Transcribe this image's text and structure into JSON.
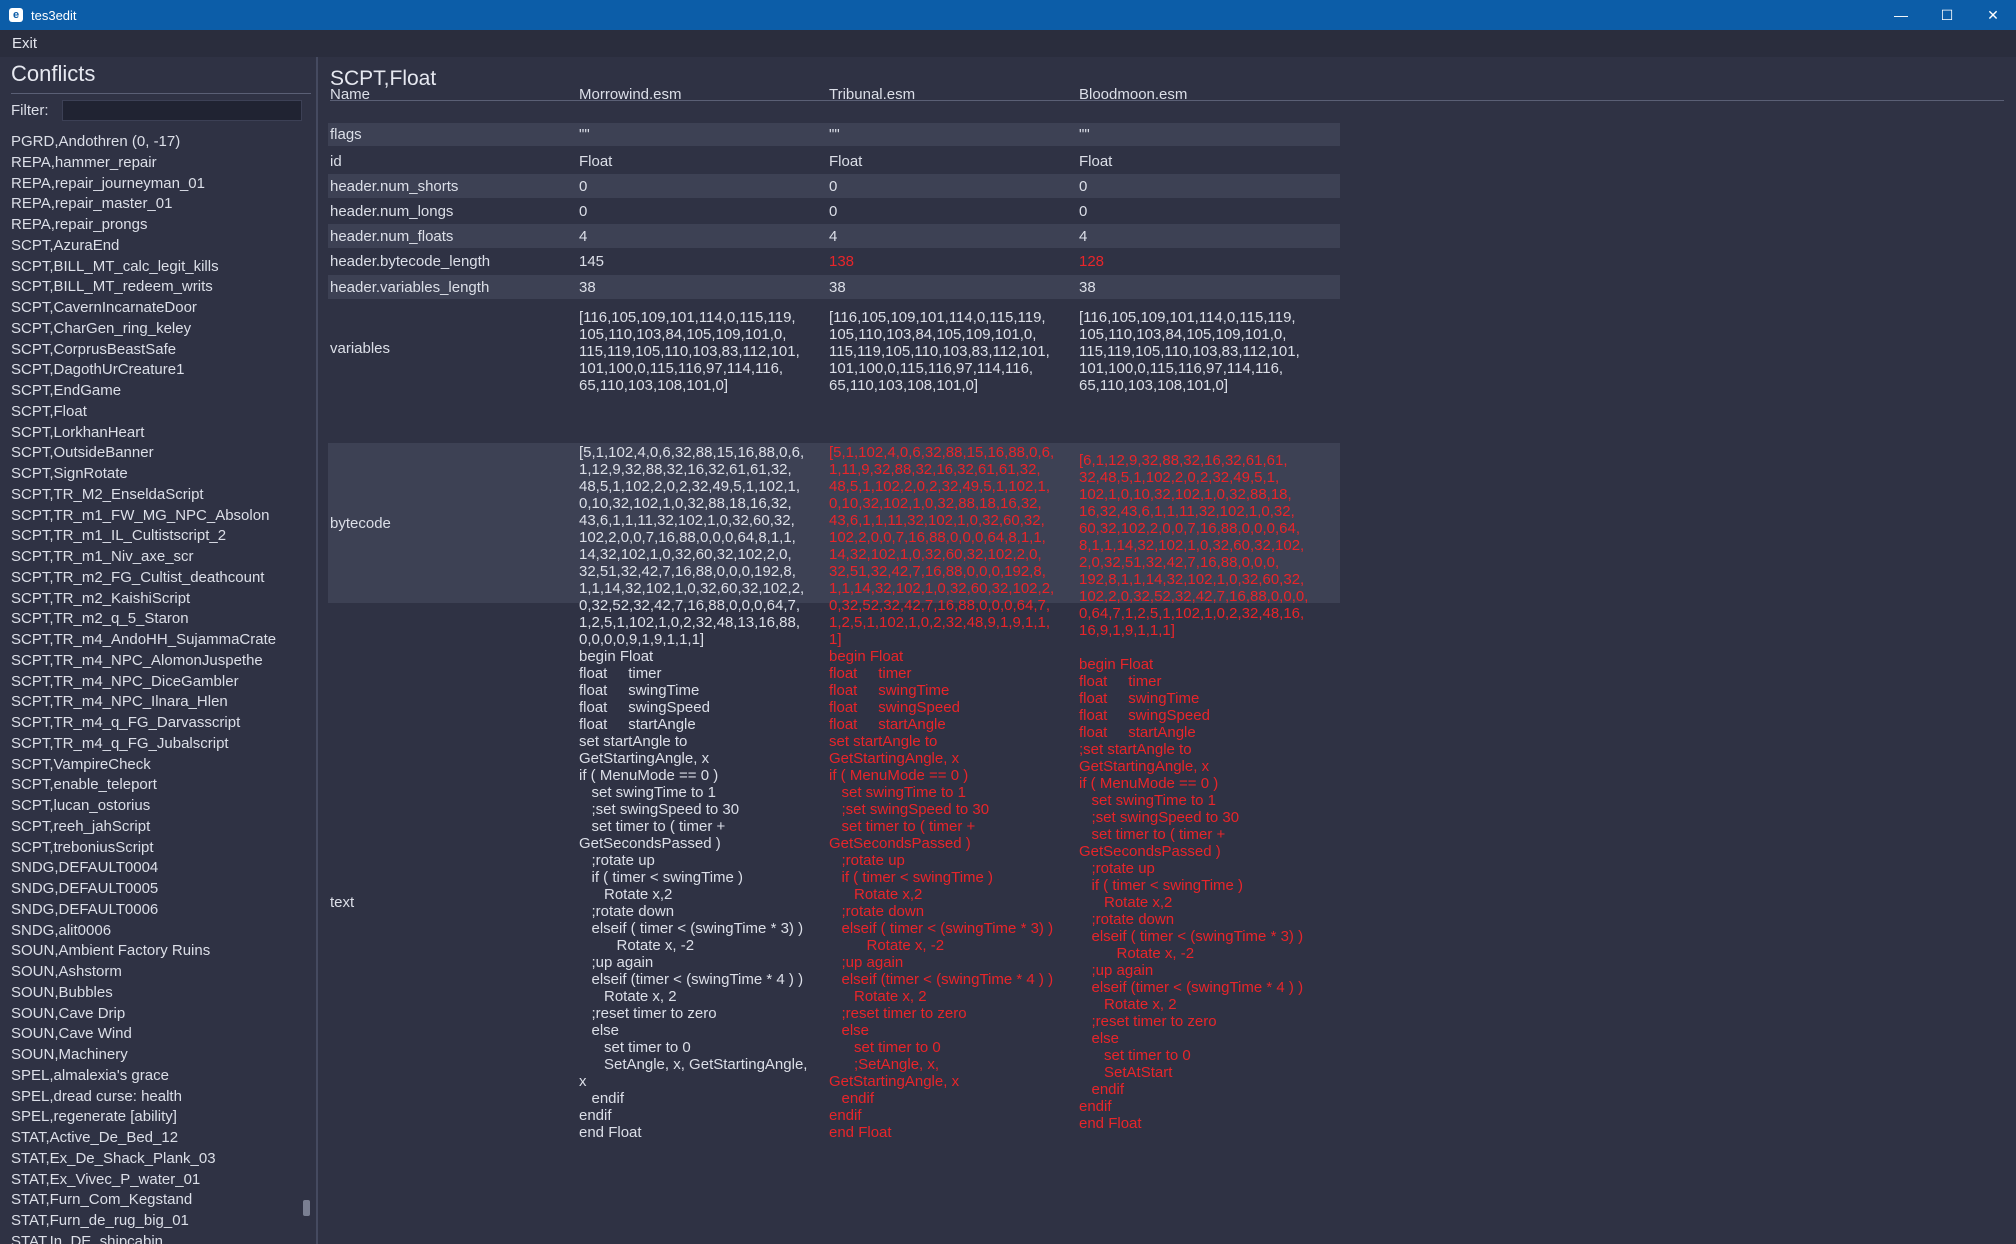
{
  "window": {
    "title": "tes3edit",
    "icon_letter": "e",
    "controls": {
      "minimize": "—",
      "maximize": "☐",
      "close": "✕"
    }
  },
  "menu": {
    "exit": "Exit"
  },
  "left": {
    "title": "Conflicts",
    "filter_label": "Filter:",
    "filter_value": "",
    "items": [
      "PGRD,Andothren (0, -17)",
      "REPA,hammer_repair",
      "REPA,repair_journeyman_01",
      "REPA,repair_master_01",
      "REPA,repair_prongs",
      "SCPT,AzuraEnd",
      "SCPT,BILL_MT_calc_legit_kills",
      "SCPT,BILL_MT_redeem_writs",
      "SCPT,CavernIncarnateDoor",
      "SCPT,CharGen_ring_keley",
      "SCPT,CorprusBeastSafe",
      "SCPT,DagothUrCreature1",
      "SCPT,EndGame",
      "SCPT,Float",
      "SCPT,LorkhanHeart",
      "SCPT,OutsideBanner",
      "SCPT,SignRotate",
      "SCPT,TR_M2_EnseldaScript",
      "SCPT,TR_m1_FW_MG_NPC_Absolon",
      "SCPT,TR_m1_IL_Cultistscript_2",
      "SCPT,TR_m1_Niv_axe_scr",
      "SCPT,TR_m2_FG_Cultist_deathcount",
      "SCPT,TR_m2_KaishiScript",
      "SCPT,TR_m2_q_5_Staron",
      "SCPT,TR_m4_AndoHH_SujammaCrate",
      "SCPT,TR_m4_NPC_AlomonJuspethe",
      "SCPT,TR_m4_NPC_DiceGambler",
      "SCPT,TR_m4_NPC_Ilnara_Hlen",
      "SCPT,TR_m4_q_FG_Darvasscript",
      "SCPT,TR_m4_q_FG_Jubalscript",
      "SCPT,VampireCheck",
      "SCPT,enable_teleport",
      "SCPT,lucan_ostorius",
      "SCPT,reeh_jahScript",
      "SCPT,treboniusScript",
      "SNDG,DEFAULT0004",
      "SNDG,DEFAULT0005",
      "SNDG,DEFAULT0006",
      "SNDG,alit0006",
      "SOUN,Ambient Factory Ruins",
      "SOUN,Ashstorm",
      "SOUN,Bubbles",
      "SOUN,Cave Drip",
      "SOUN,Cave Wind",
      "SOUN,Machinery",
      "SPEL,almalexia's grace",
      "SPEL,dread curse: health",
      "SPEL,regenerate [ability]",
      "STAT,Active_De_Bed_12",
      "STAT,Ex_De_Shack_Plank_03",
      "STAT,Ex_Vivec_P_water_01",
      "STAT,Furn_Com_Kegstand",
      "STAT,Furn_de_rug_big_01",
      "STAT,In_DE_shipcabin"
    ]
  },
  "record": {
    "title": "SCPT,Float",
    "columns": [
      "Name",
      "Morrowind.esm",
      "Tribunal.esm",
      "Bloodmoon.esm"
    ],
    "rows": [
      {
        "name": "flags",
        "values": [
          "\"\"",
          "\"\"",
          "\"\""
        ],
        "diff": [
          false,
          false,
          false
        ]
      },
      {
        "name": "id",
        "values": [
          "Float",
          "Float",
          "Float"
        ],
        "diff": [
          false,
          false,
          false
        ]
      },
      {
        "name": "header.num_shorts",
        "values": [
          "0",
          "0",
          "0"
        ],
        "diff": [
          false,
          false,
          false
        ]
      },
      {
        "name": "header.num_longs",
        "values": [
          "0",
          "0",
          "0"
        ],
        "diff": [
          false,
          false,
          false
        ]
      },
      {
        "name": "header.num_floats",
        "values": [
          "4",
          "4",
          "4"
        ],
        "diff": [
          false,
          false,
          false
        ]
      },
      {
        "name": "header.bytecode_length",
        "values": [
          "145",
          "138",
          "128"
        ],
        "diff": [
          false,
          true,
          true
        ]
      },
      {
        "name": "header.variables_length",
        "values": [
          "38",
          "38",
          "38"
        ],
        "diff": [
          false,
          false,
          false
        ]
      },
      {
        "name": "variables",
        "values": [
          "[116,105,109,101,114,0,115,119,\n105,110,103,84,105,109,101,0,\n115,119,105,110,103,83,112,101,\n101,100,0,115,116,97,114,116,\n65,110,103,108,101,0]",
          "[116,105,109,101,114,0,115,119,\n105,110,103,84,105,109,101,0,\n115,119,105,110,103,83,112,101,\n101,100,0,115,116,97,114,116,\n65,110,103,108,101,0]",
          "[116,105,109,101,114,0,115,119,\n105,110,103,84,105,109,101,0,\n115,119,105,110,103,83,112,101,\n101,100,0,115,116,97,114,116,\n65,110,103,108,101,0]"
        ],
        "diff": [
          false,
          false,
          false
        ]
      },
      {
        "name": "bytecode",
        "values": [
          "[5,1,102,4,0,6,32,88,15,16,88,0,6,\n1,12,9,32,88,32,16,32,61,61,32,\n48,5,1,102,2,0,2,32,49,5,1,102,1,\n0,10,32,102,1,0,32,88,18,16,32,\n43,6,1,1,11,32,102,1,0,32,60,32,\n102,2,0,0,7,16,88,0,0,0,64,8,1,1,\n14,32,102,1,0,32,60,32,102,2,0,\n32,51,32,42,7,16,88,0,0,0,192,8,\n1,1,14,32,102,1,0,32,60,32,102,2,\n0,32,52,32,42,7,16,88,0,0,0,64,7,\n1,2,5,1,102,1,0,2,32,48,13,16,88,\n0,0,0,0,9,1,9,1,1,1]",
          "[5,1,102,4,0,6,32,88,15,16,88,0,6,\n1,11,9,32,88,32,16,32,61,61,32,\n48,5,1,102,2,0,2,32,49,5,1,102,1,\n0,10,32,102,1,0,32,88,18,16,32,\n43,6,1,1,11,32,102,1,0,32,60,32,\n102,2,0,0,7,16,88,0,0,0,64,8,1,1,\n14,32,102,1,0,32,60,32,102,2,0,\n32,51,32,42,7,16,88,0,0,0,192,8,\n1,1,14,32,102,1,0,32,60,32,102,2,\n0,32,52,32,42,7,16,88,0,0,0,64,7,\n1,2,5,1,102,1,0,2,32,48,9,1,9,1,1,\n1]",
          "[6,1,12,9,32,88,32,16,32,61,61,\n32,48,5,1,102,2,0,2,32,49,5,1,\n102,1,0,10,32,102,1,0,32,88,18,\n16,32,43,6,1,1,11,32,102,1,0,32,\n60,32,102,2,0,0,7,16,88,0,0,0,64,\n8,1,1,14,32,102,1,0,32,60,32,102,\n2,0,32,51,32,42,7,16,88,0,0,0,\n192,8,1,1,14,32,102,1,0,32,60,32,\n102,2,0,32,52,32,42,7,16,88,0,0,0,\n0,64,7,1,2,5,1,102,1,0,2,32,48,16,\n16,9,1,9,1,1,1]"
        ],
        "diff": [
          false,
          true,
          true
        ]
      },
      {
        "name": "text",
        "values": [
          "begin Float\nfloat     timer\nfloat     swingTime\nfloat     swingSpeed\nfloat     startAngle\nset startAngle to\nGetStartingAngle, x\nif ( MenuMode == 0 )\n   set swingTime to 1\n   ;set swingSpeed to 30\n   set timer to ( timer +\nGetSecondsPassed )\n   ;rotate up\n   if ( timer < swingTime )\n      Rotate x,2\n   ;rotate down\n   elseif ( timer < (swingTime * 3) )\n         Rotate x, -2\n   ;up again\n   elseif (timer < (swingTime * 4 ) )\n      Rotate x, 2\n   ;reset timer to zero\n   else\n      set timer to 0\n      SetAngle, x, GetStartingAngle,\nx\n   endif\nendif\nend Float",
          "begin Float\nfloat     timer\nfloat     swingTime\nfloat     swingSpeed\nfloat     startAngle\nset startAngle to\nGetStartingAngle, x\nif ( MenuMode == 0 )\n   set swingTime to 1\n   ;set swingSpeed to 30\n   set timer to ( timer +\nGetSecondsPassed )\n   ;rotate up\n   if ( timer < swingTime )\n      Rotate x,2\n   ;rotate down\n   elseif ( timer < (swingTime * 3) )\n         Rotate x, -2\n   ;up again\n   elseif (timer < (swingTime * 4 ) )\n      Rotate x, 2\n   ;reset timer to zero\n   else\n      set timer to 0\n      ;SetAngle, x,\nGetStartingAngle, x\n   endif\nendif\nend Float",
          "begin Float\nfloat     timer\nfloat     swingTime\nfloat     swingSpeed\nfloat     startAngle\n;set startAngle to\nGetStartingAngle, x\nif ( MenuMode == 0 )\n   set swingTime to 1\n   ;set swingSpeed to 30\n   set timer to ( timer +\nGetSecondsPassed )\n   ;rotate up\n   if ( timer < swingTime )\n      Rotate x,2\n   ;rotate down\n   elseif ( timer < (swingTime * 3) )\n         Rotate x, -2\n   ;up again\n   elseif (timer < (swingTime * 4 ) )\n      Rotate x, 2\n   ;reset timer to zero\n   else\n      set timer to 0\n      SetAtStart\n   endif\nendif\nend Float"
        ],
        "diff": [
          false,
          true,
          true
        ]
      }
    ]
  },
  "colors": {
    "titlebar": "#0c5da8",
    "background": "#2f3244",
    "row_shade": "#3d4154",
    "text": "#dcdfe8",
    "diff_text": "#e8252a"
  },
  "icons": [
    "app-icon",
    "minimize-icon",
    "maximize-icon",
    "close-icon"
  ]
}
